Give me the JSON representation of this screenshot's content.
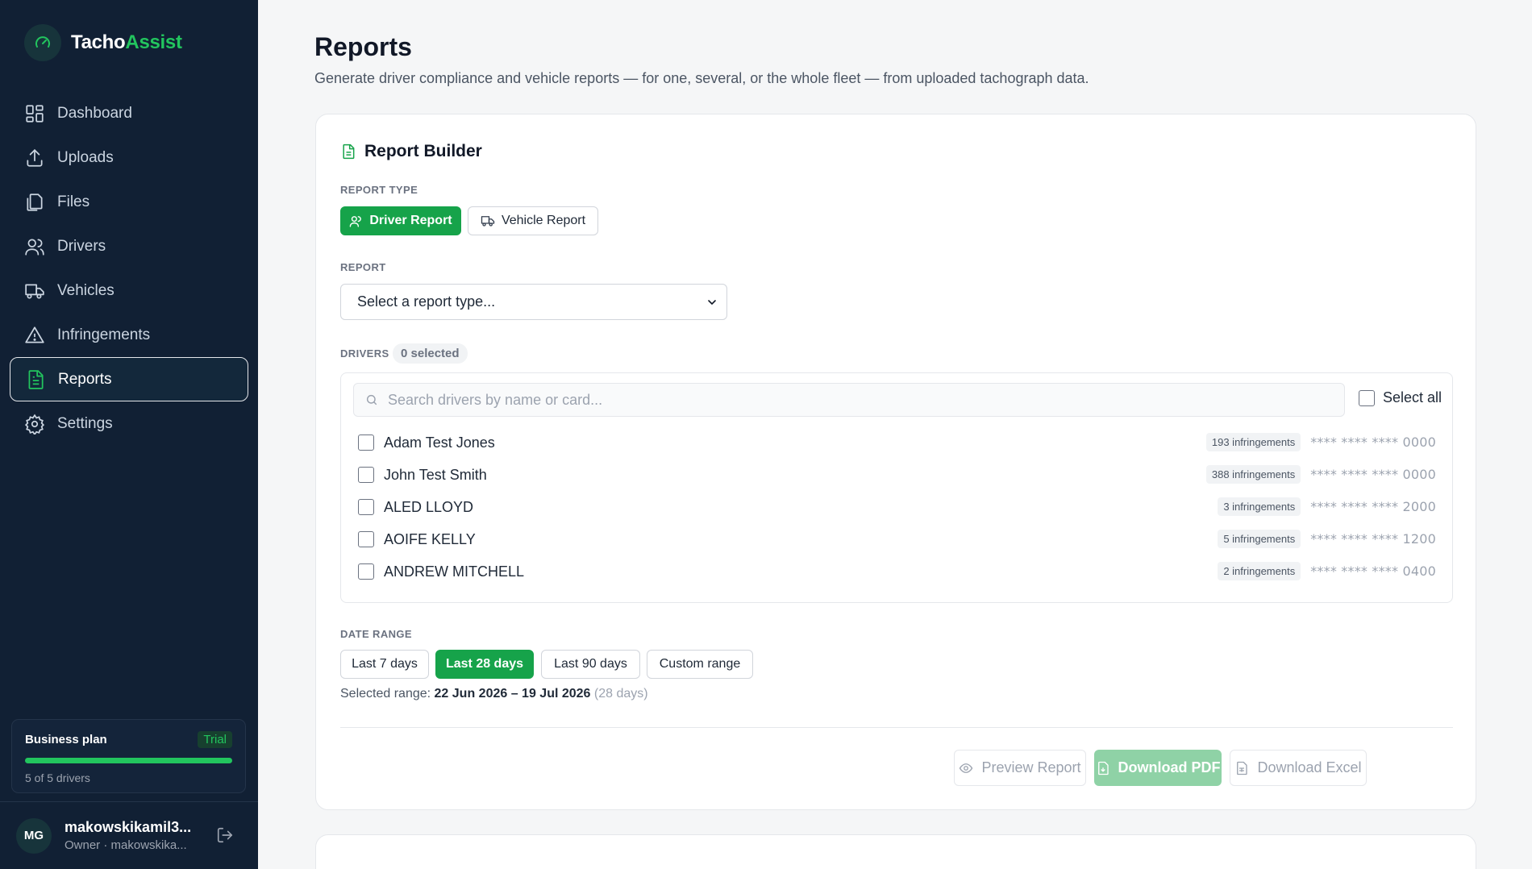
{
  "app": {
    "name_part1": "Tacho",
    "name_part2": "Assist",
    "brand_color": "#22c55e",
    "sidebar_bg": "#112034"
  },
  "sidebar": {
    "items": [
      {
        "label": "Dashboard",
        "icon": "dashboard-icon"
      },
      {
        "label": "Uploads",
        "icon": "upload-icon"
      },
      {
        "label": "Files",
        "icon": "files-icon"
      },
      {
        "label": "Drivers",
        "icon": "users-icon"
      },
      {
        "label": "Vehicles",
        "icon": "truck-icon"
      },
      {
        "label": "Infringements",
        "icon": "warning-icon"
      },
      {
        "label": "Reports",
        "icon": "report-icon",
        "active": true
      },
      {
        "label": "Settings",
        "icon": "gear-icon"
      }
    ],
    "plan": {
      "name": "Business plan",
      "badge": "Trial",
      "usage_fraction": 1.0,
      "usage_text": "5 of 5 drivers"
    },
    "user": {
      "initials": "MG",
      "name": "makowskikamil3...",
      "role": "Owner · makowskika..."
    }
  },
  "page": {
    "title": "Reports",
    "subtitle": "Generate driver compliance and vehicle reports — for one, several, or the whole fleet — from uploaded tachograph data."
  },
  "builder": {
    "title": "Report Builder",
    "report_type_label": "REPORT TYPE",
    "report_types": [
      {
        "label": "Driver Report",
        "selected": true
      },
      {
        "label": "Vehicle Report",
        "selected": false
      }
    ],
    "report_label": "REPORT",
    "report_select_value": "Select a report type...",
    "drivers_label": "DRIVERS",
    "selected_count": "0 selected",
    "search_placeholder": "Search drivers by name or card...",
    "select_all_label": "Select all",
    "drivers": [
      {
        "name": "Adam Test Jones",
        "infringements": "193 infringements",
        "card": "**** **** **** 0000"
      },
      {
        "name": "John Test Smith",
        "infringements": "388 infringements",
        "card": "**** **** **** 0000"
      },
      {
        "name": "ALED LLOYD",
        "infringements": "3 infringements",
        "card": "**** **** **** 2000"
      },
      {
        "name": "AOIFE KELLY",
        "infringements": "5 infringements",
        "card": "**** **** **** 1200"
      },
      {
        "name": "ANDREW MITCHELL",
        "infringements": "2 infringements",
        "card": "**** **** **** 0400"
      }
    ],
    "date_range_label": "DATE RANGE",
    "date_ranges": [
      {
        "label": "Last 7 days",
        "selected": false
      },
      {
        "label": "Last 28 days",
        "selected": true
      },
      {
        "label": "Last 90 days",
        "selected": false
      },
      {
        "label": "Custom range",
        "selected": false
      }
    ],
    "selected_range_prefix": "Selected range:",
    "selected_range_value": "22 Jun 2026 – 19 Jul 2026",
    "selected_range_days": "(28 days)",
    "actions": {
      "preview": "Preview Report",
      "pdf": "Download PDF",
      "excel": "Download Excel"
    }
  }
}
